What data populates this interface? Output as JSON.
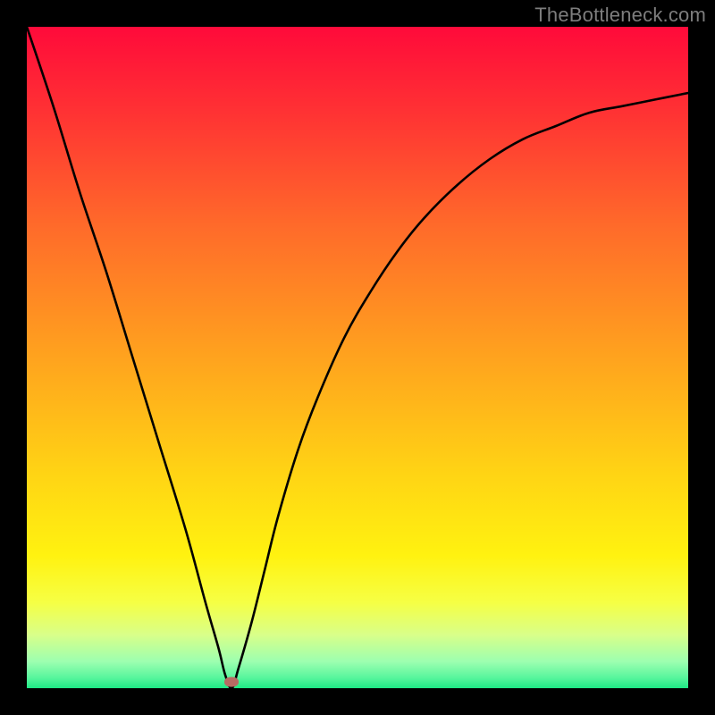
{
  "watermark": "TheBottleneck.com",
  "marker": {
    "x_pct": 31.0,
    "y_pct": 99.0
  },
  "gradient_stops": [
    {
      "offset": 0,
      "color": "#ff0a3a"
    },
    {
      "offset": 0.12,
      "color": "#ff2f34"
    },
    {
      "offset": 0.3,
      "color": "#ff6a2a"
    },
    {
      "offset": 0.5,
      "color": "#ffa31e"
    },
    {
      "offset": 0.68,
      "color": "#ffd514"
    },
    {
      "offset": 0.8,
      "color": "#fff210"
    },
    {
      "offset": 0.87,
      "color": "#f6ff44"
    },
    {
      "offset": 0.92,
      "color": "#d8ff8a"
    },
    {
      "offset": 0.96,
      "color": "#9cffb0"
    },
    {
      "offset": 0.985,
      "color": "#55f59c"
    },
    {
      "offset": 1.0,
      "color": "#1ee884"
    }
  ],
  "chart_data": {
    "type": "line",
    "title": "",
    "xlabel": "",
    "ylabel": "",
    "xlim": [
      0,
      100
    ],
    "ylim": [
      0,
      100
    ],
    "legend": false,
    "grid": false,
    "series": [
      {
        "name": "bottleneck-curve",
        "x": [
          0,
          4,
          8,
          12,
          16,
          20,
          24,
          27,
          29,
          30,
          31,
          32,
          34,
          36,
          38,
          41,
          44,
          48,
          52,
          56,
          60,
          65,
          70,
          75,
          80,
          85,
          90,
          95,
          100
        ],
        "values": [
          100,
          88,
          75,
          63,
          50,
          37,
          24,
          13,
          6,
          2,
          0,
          3,
          10,
          18,
          26,
          36,
          44,
          53,
          60,
          66,
          71,
          76,
          80,
          83,
          85,
          87,
          88,
          89,
          90
        ]
      }
    ],
    "annotations": [
      {
        "type": "marker",
        "x": 31,
        "y": 0,
        "label": "optimal-point"
      }
    ]
  }
}
